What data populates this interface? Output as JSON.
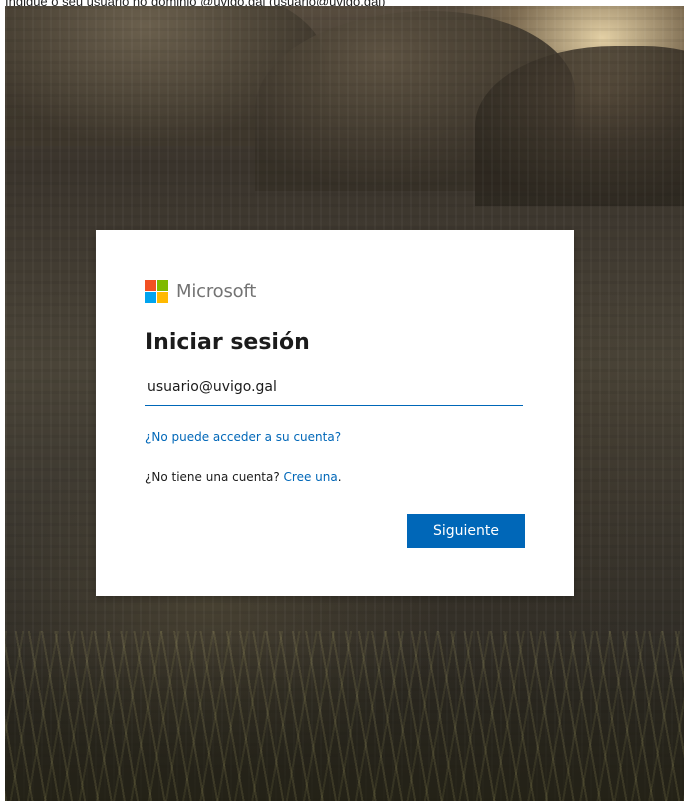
{
  "caption": "Indique o seu usuario no dominio @uvigo.gal (usuario@uvigo.gal)",
  "logo": {
    "wordmark": "Microsoft",
    "colors": [
      "#f25022",
      "#7fba00",
      "#00a4ef",
      "#ffb900"
    ]
  },
  "signin": {
    "title": "Iniciar sesión",
    "email_value": "usuario@uvigo.gal",
    "cant_access_link": "¿No puede acceder a su cuenta?",
    "no_account_text": "¿No tiene una cuenta? ",
    "create_link": "Cree una",
    "create_suffix": ".",
    "next_button": "Siguiente"
  },
  "colors": {
    "accent": "#0067b8",
    "text": "#1b1b1b",
    "wordmark": "#737373"
  }
}
